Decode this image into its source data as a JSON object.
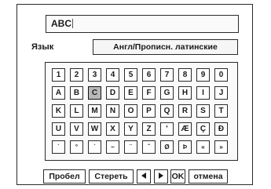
{
  "input": {
    "value": "ABC"
  },
  "language": {
    "label": "Язык",
    "value": "Англ/Прописн. латинские"
  },
  "keyboard": {
    "selected": "C",
    "rows": [
      [
        "1",
        "2",
        "3",
        "4",
        "5",
        "6",
        "7",
        "8",
        "9",
        "0"
      ],
      [
        "A",
        "B",
        "C",
        "D",
        "E",
        "F",
        "G",
        "H",
        "I",
        "J"
      ],
      [
        "K",
        "L",
        "M",
        "N",
        "O",
        "P",
        "Q",
        "R",
        "S",
        "T"
      ],
      [
        "U",
        "V",
        "W",
        "X",
        "Y",
        "Z",
        "'",
        "Æ",
        "Ç",
        "Đ"
      ],
      [
        "´",
        "°",
        "`",
        "~",
        "¨",
        "ˆ",
        "Ø",
        "Þ",
        "«",
        "»"
      ]
    ]
  },
  "buttons": {
    "space": "Пробел",
    "erase": "Стереть",
    "left_icon": "left-arrow-icon",
    "right_icon": "right-arrow-icon",
    "ok": "OK",
    "cancel": "отмена"
  },
  "colors": {
    "border": "#2a2a2a",
    "selected_key": "#b8b8b8",
    "background": "#ffffff"
  }
}
